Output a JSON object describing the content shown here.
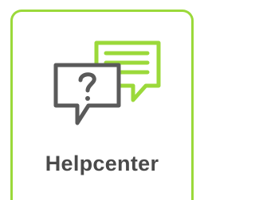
{
  "tile": {
    "label": "Helpcenter",
    "icon": "help-chat-bubbles-icon"
  },
  "colors": {
    "accent": "#9bd93a",
    "icon_dark": "#5a5a5a",
    "text": "#4a4a4a"
  }
}
